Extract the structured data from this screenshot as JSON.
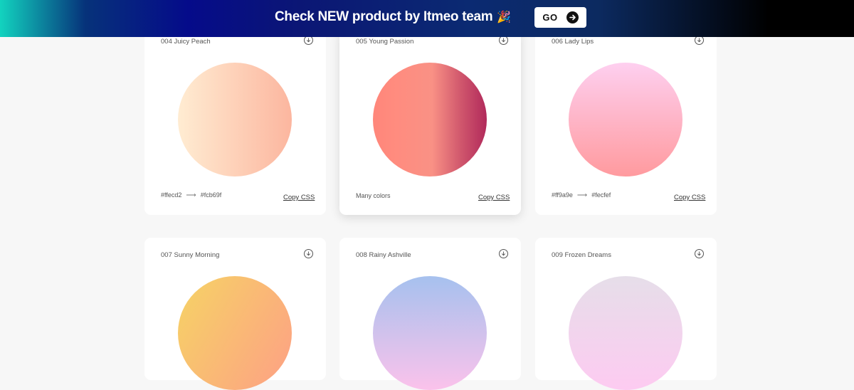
{
  "banner": {
    "text": "Check NEW product by Itmeo team",
    "emoji": "🎉",
    "go_label": "GO"
  },
  "cards": [
    {
      "title": "004 Juicy Peach",
      "from": "#ffecd2",
      "to": "#fcb69f",
      "from_label": "#ffecd2",
      "to_label": "#fcb69f",
      "colors_text": "",
      "copy": "Copy CSS"
    },
    {
      "title": "005 Young Passion",
      "colors_text": "Many colors",
      "copy": "Copy CSS"
    },
    {
      "title": "006 Lady Lips",
      "from": "#ff9a9e",
      "to": "#fecfef",
      "from_label": "#ff9a9e",
      "to_label": "#fecfef",
      "colors_text": "",
      "copy": "Copy CSS"
    },
    {
      "title": "007 Sunny Morning"
    },
    {
      "title": "008 Rainy Ashville"
    },
    {
      "title": "009 Frozen Dreams"
    }
  ],
  "gradients": {
    "juicy_peach": [
      "#ffecd2",
      "#fcb69f"
    ],
    "young_passion": [
      "#ff8177",
      "#ff867a",
      "#ff8c7f",
      "#f99185",
      "#cf556c",
      "#b12a5b"
    ],
    "lady_lips": [
      "#ff9a9e",
      "#fecfef"
    ],
    "sunny_morning": [
      "#f6d365",
      "#fda085"
    ],
    "rainy_ashville": [
      "#fbc2eb",
      "#a6c1ee"
    ],
    "frozen_dreams": [
      "#fdcbf1",
      "#e6dee9"
    ]
  }
}
